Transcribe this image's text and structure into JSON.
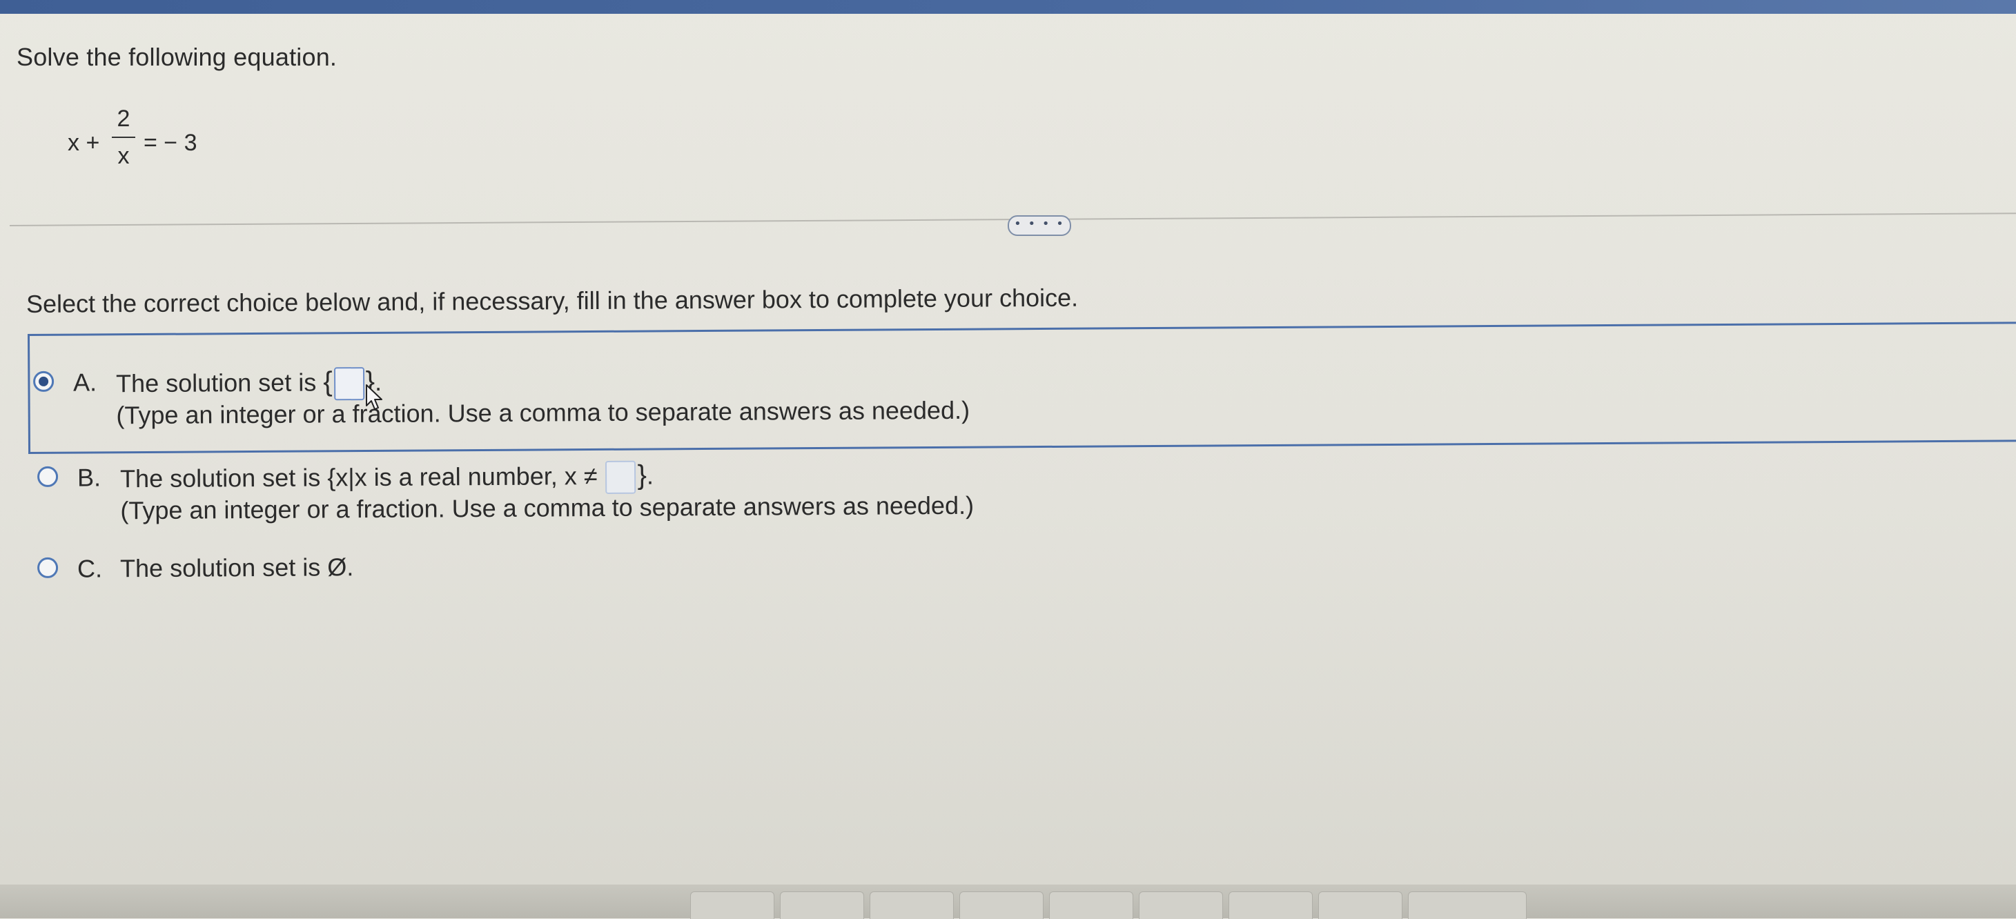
{
  "question": {
    "prompt": "Solve the following equation.",
    "equation": {
      "lhs": "x +",
      "numerator": "2",
      "denominator": "x",
      "rhs": "= − 3"
    }
  },
  "more_button_label": "• • • •",
  "instruction": "Select the correct choice below and, if necessary, fill in the answer box to complete your choice.",
  "choices": [
    {
      "letter": "A.",
      "line1_prefix": "The solution set is",
      "line1_open": "{",
      "line1_close": "}",
      "line1_suffix": ".",
      "hint": "(Type an integer or a fraction. Use a comma to separate answers as needed.)",
      "selected": true
    },
    {
      "letter": "B.",
      "line1_prefix": "The solution set is",
      "line1_open": "{x|x is a real number, x ≠",
      "line1_close": "}",
      "line1_suffix": ".",
      "hint": "(Type an integer or a fraction. Use a comma to separate answers as needed.)",
      "selected": false
    },
    {
      "letter": "C.",
      "line1_prefix": "The solution set is Ø.",
      "selected": false
    }
  ],
  "colors": {
    "accent": "#4b6faa",
    "top_bar": "#4a6aa0",
    "background": "#e6e5de"
  },
  "icons": {
    "cursor": "mouse-pointer-icon"
  }
}
